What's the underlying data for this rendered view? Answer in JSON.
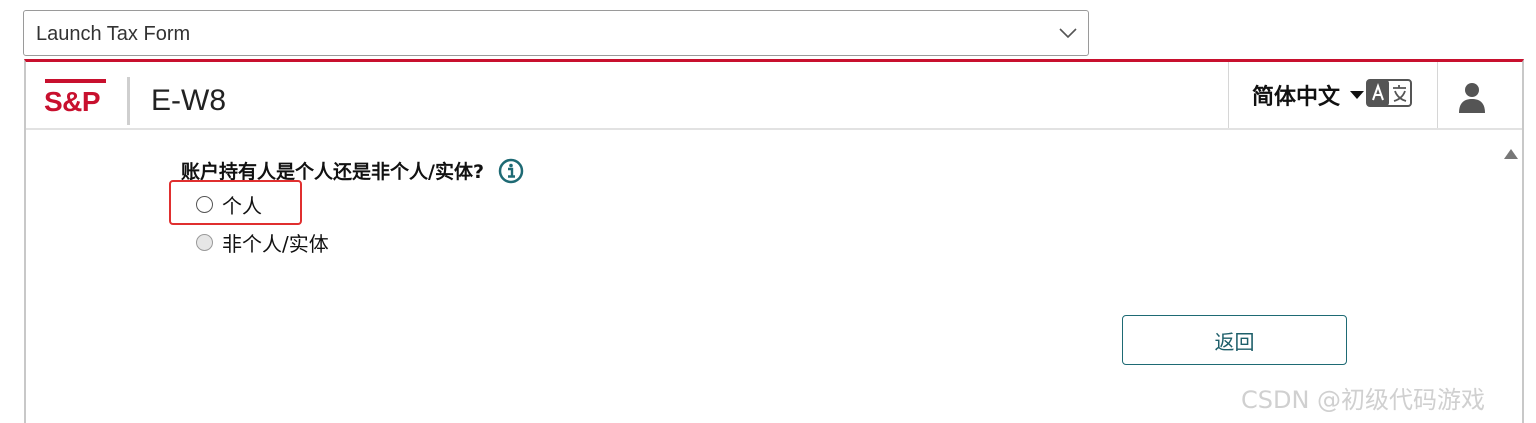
{
  "select": {
    "value": "Launch Tax Form",
    "icon": "chevron-down-icon"
  },
  "header": {
    "logo_text": "S&P",
    "app_title": "E-W8",
    "language_label": "简体中文",
    "brand_color": "#c8102e"
  },
  "form": {
    "question": "账户持有人是个人还是非个人/实体?",
    "options": [
      {
        "label": "个人",
        "selected": false
      },
      {
        "label": "非个人/实体",
        "selected": false
      }
    ],
    "back_label": "返回",
    "accent_color": "#1e6a74"
  },
  "watermark": "CSDN @初级代码游戏"
}
